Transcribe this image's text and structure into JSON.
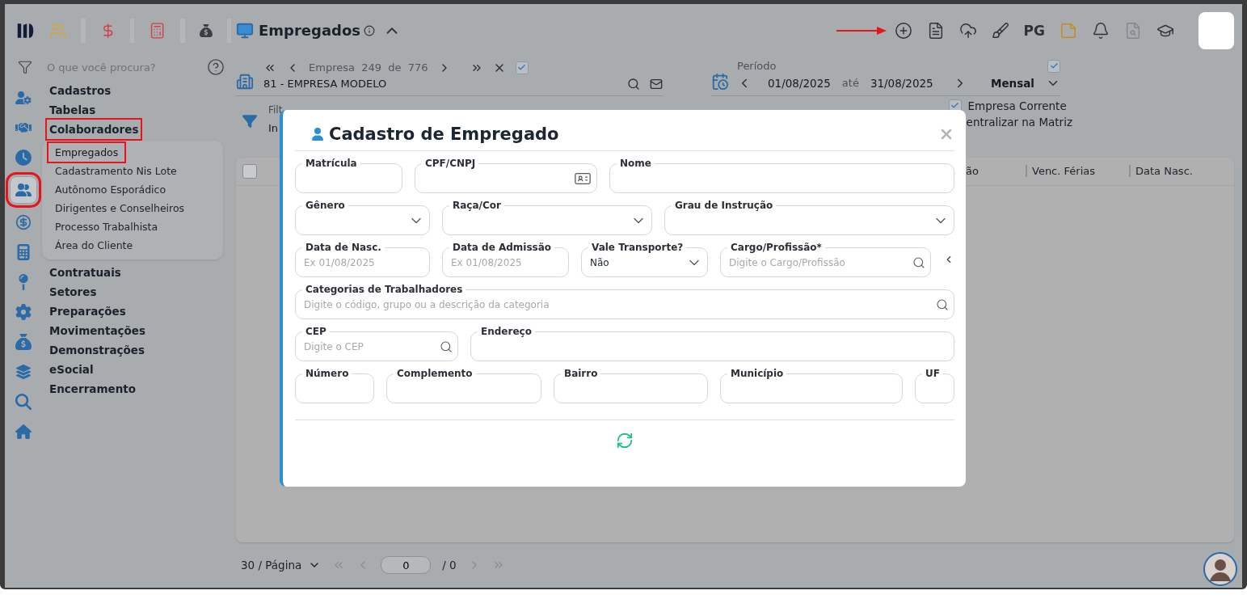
{
  "sidebar": {
    "search": {
      "placeholder": "O que você procura?"
    },
    "rail": [
      {
        "selected": false,
        "highlighted": false
      },
      {
        "selected": false,
        "highlighted": false
      },
      {
        "selected": false,
        "highlighted": false
      },
      {
        "selected": true,
        "highlighted": true
      },
      {
        "selected": false,
        "highlighted": false
      },
      {
        "selected": false,
        "highlighted": false
      },
      {
        "selected": false,
        "highlighted": false
      },
      {
        "selected": false,
        "highlighted": false
      },
      {
        "selected": false,
        "highlighted": false
      },
      {
        "selected": false,
        "highlighted": false
      },
      {
        "selected": false,
        "highlighted": false
      },
      {
        "selected": false,
        "highlighted": false
      }
    ],
    "nav": [
      {
        "label": "Cadastros",
        "highlighted": false
      },
      {
        "label": "Tabelas",
        "highlighted": false
      },
      {
        "label": "Colaboradores",
        "expanded": true,
        "highlighted": true,
        "children": [
          {
            "label": "Empregados",
            "selected": true,
            "highlighted": true
          },
          {
            "label": "Cadastramento Nis Lote",
            "selected": false,
            "highlighted": false
          },
          {
            "label": "Autônomo Esporádico",
            "selected": false,
            "highlighted": false
          },
          {
            "label": "Dirigentes e Conselheiros",
            "selected": false,
            "highlighted": false
          },
          {
            "label": "Processo Trabalhista",
            "selected": false,
            "highlighted": false
          },
          {
            "label": "Área do Cliente",
            "selected": false,
            "highlighted": false
          }
        ]
      },
      {
        "label": "Contratuais",
        "highlighted": false
      },
      {
        "label": "Setores",
        "highlighted": false
      },
      {
        "label": "Preparações",
        "highlighted": false
      },
      {
        "label": "Movimentações",
        "highlighted": false
      },
      {
        "label": "Demonstrações",
        "highlighted": false
      },
      {
        "label": "eSocial",
        "highlighted": false
      },
      {
        "label": "Encerramento",
        "highlighted": false
      }
    ]
  },
  "header": {
    "title": "Empregados",
    "toolbar": [
      {
        "kind": "add",
        "pointed": true,
        "disabled": false
      },
      {
        "kind": "document",
        "disabled": false
      },
      {
        "kind": "upload",
        "disabled": false
      },
      {
        "kind": "broom",
        "disabled": false
      },
      {
        "kind": "text",
        "label": "PG",
        "disabled": false
      },
      {
        "kind": "note",
        "disabled": false
      },
      {
        "kind": "bell",
        "disabled": false
      },
      {
        "kind": "report",
        "disabled": true
      },
      {
        "kind": "graduation",
        "disabled": false
      }
    ]
  },
  "company": {
    "counter": "Empresa  249  de  776",
    "checked": true,
    "name": "81 - EMPRESA MODELO"
  },
  "period": {
    "label": "Período",
    "checked": true,
    "start": "01/08/2025",
    "separator": "até",
    "end": "31/08/2025",
    "mode": "Mensal"
  },
  "filters": {
    "label": "Filt",
    "value": "In",
    "options": [
      {
        "label": "Empresa Corrente",
        "checked": true
      },
      {
        "label": "entralizar na Matriz"
      }
    ]
  },
  "table": {
    "select_all_checked": false,
    "columns": [
      "ão",
      "Venc. Férias",
      "Data Nasc."
    ]
  },
  "pagination": {
    "page_size": "30 / Página",
    "page": "0",
    "total": "/ 0"
  },
  "modal": {
    "title": "Cadastro de Empregado",
    "rows": [
      {
        "fields": [
          {
            "label": "Matrícula",
            "kind": "text"
          },
          {
            "label": "CPF/CNPJ",
            "kind": "document"
          },
          {
            "label": "Nome",
            "kind": "text"
          }
        ]
      },
      {
        "fields": [
          {
            "label": "Gênero",
            "kind": "select"
          },
          {
            "label": "Raça/Cor",
            "kind": "select"
          },
          {
            "label": "Grau de Instrução",
            "kind": "select"
          }
        ]
      },
      {
        "side_button": true,
        "fields": [
          {
            "label": "Data de Nasc.",
            "kind": "date",
            "placeholder": "Ex 01/08/2025"
          },
          {
            "label": "Data de Admissão",
            "kind": "date",
            "placeholder": "Ex 01/08/2025"
          },
          {
            "label": "Vale Transporte?",
            "kind": "select",
            "value": "Não"
          },
          {
            "label": "Cargo/Profissão*",
            "kind": "search",
            "placeholder": "Digite o Cargo/Profissão"
          }
        ]
      },
      {
        "fields": [
          {
            "label": "Categorias de Trabalhadores",
            "kind": "search",
            "placeholder": "Digite o código, grupo ou a descrição da categoria"
          }
        ]
      },
      {
        "fields": [
          {
            "label": "CEP",
            "kind": "search",
            "placeholder": "Digite o CEP"
          },
          {
            "label": "Endereço",
            "kind": "text"
          }
        ]
      },
      {
        "fields": [
          {
            "label": "Número",
            "kind": "text"
          },
          {
            "label": "Complemento",
            "kind": "text"
          },
          {
            "label": "Bairro",
            "kind": "text"
          },
          {
            "label": "Município",
            "kind": "text"
          },
          {
            "label": "UF",
            "kind": "text"
          }
        ]
      }
    ]
  }
}
